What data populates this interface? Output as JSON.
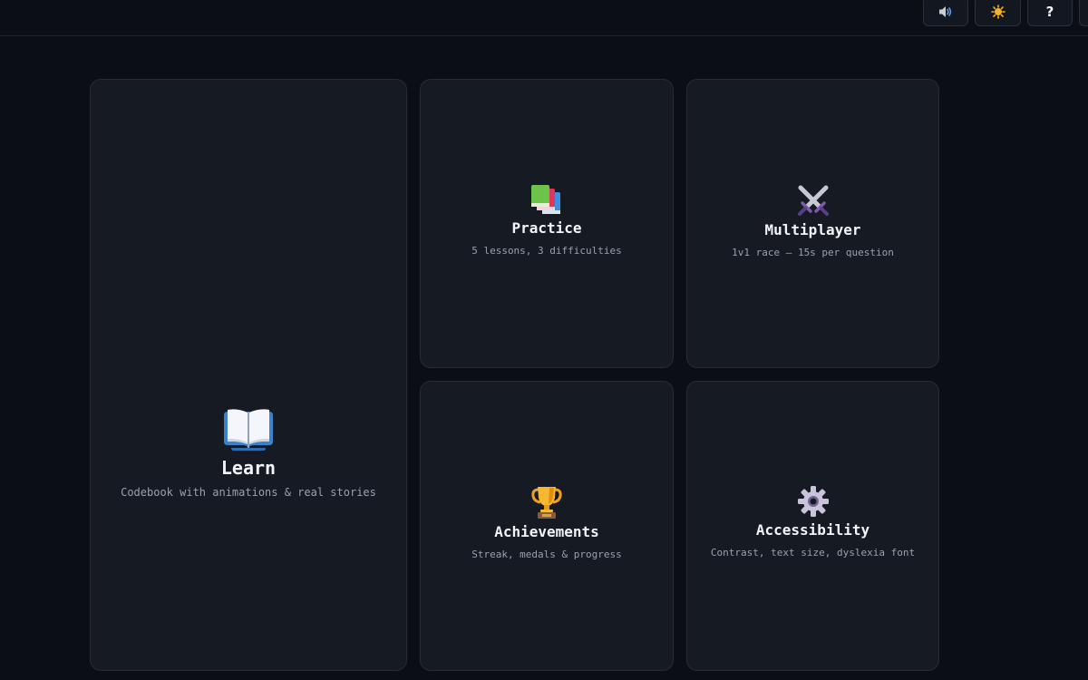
{
  "topbar": {
    "buttons": [
      {
        "icon": "speaker-icon"
      },
      {
        "icon": "sun-icon"
      },
      {
        "icon": "help-icon",
        "label": "?"
      },
      {
        "icon": "more-icon"
      }
    ]
  },
  "cards": {
    "learn": {
      "icon": "open-book-icon",
      "title": "Learn",
      "subtitle": "Codebook with animations & real stories"
    },
    "practice": {
      "icon": "books-icon",
      "title": "Practice",
      "subtitle": "5 lessons, 3 difficulties"
    },
    "multiplayer": {
      "icon": "crossed-swords-icon",
      "title": "Multiplayer",
      "subtitle": "1v1 race — 15s per question"
    },
    "achievements": {
      "icon": "trophy-icon",
      "title": "Achievements",
      "subtitle": "Streak, medals & progress"
    },
    "accessibility": {
      "icon": "gear-icon",
      "title": "Accessibility",
      "subtitle": "Contrast, text size, dyslexia font"
    }
  },
  "colors": {
    "background": "#0b0e15",
    "card": "#161a23",
    "card_border": "#262b36",
    "text": "#f2f4f8",
    "muted": "#9aa1ad",
    "sun": "#f5b325"
  }
}
